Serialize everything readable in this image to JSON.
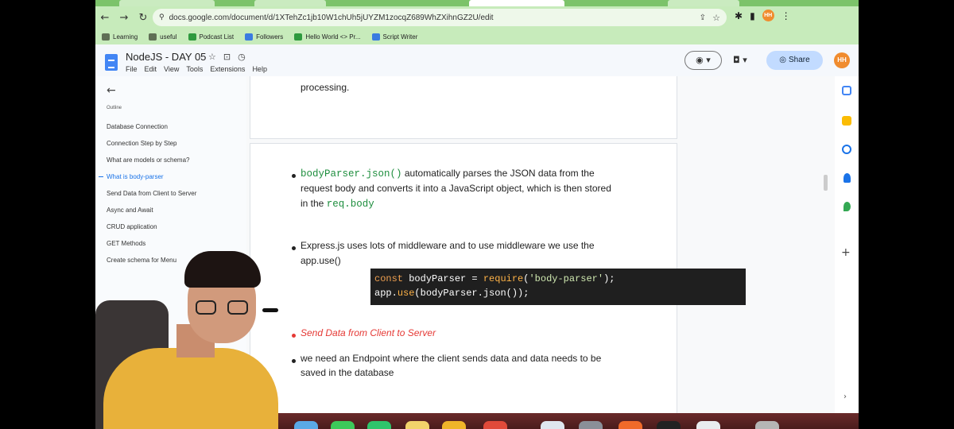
{
  "browser": {
    "url": "docs.google.com/document/d/1XTehZc1jb10W1chUh5jUYZM1zocqZ689WhZXihnGZ2U/edit",
    "profile_initials": "HH",
    "bookmarks": [
      {
        "label": "Learning",
        "icon": "folder-icon"
      },
      {
        "label": "useful",
        "icon": "folder-icon"
      },
      {
        "label": "Podcast List",
        "icon": "sheets-icon"
      },
      {
        "label": "Followers",
        "icon": "docs-icon"
      },
      {
        "label": "Hello World <> Pr...",
        "icon": "sheets-icon"
      },
      {
        "label": "Script Writer",
        "icon": "docs-icon"
      }
    ]
  },
  "doc": {
    "title": "NodeJS - DAY 05",
    "menu": [
      "File",
      "Edit",
      "View",
      "Tools",
      "Extensions",
      "Help"
    ],
    "share_label": "Share",
    "avatar_initials": "HH"
  },
  "outline": {
    "label": "Outline",
    "items": [
      "Database Connection",
      "Connection Step by Step",
      "What are models or schema?",
      "What is body-parser",
      "Send Data from Client to Server",
      "Async and Await",
      "CRUD application",
      "GET Methods",
      "Create schema for Menu"
    ],
    "active_index": 3
  },
  "content": {
    "page1_tail": "processing.",
    "bullet1": {
      "code": "bodyParser.json()",
      "line1": " automatically parses the JSON data from the",
      "line2": "request body and converts it into a JavaScript object, which is then stored",
      "line3_prefix": "in the ",
      "line3_code": "req.body"
    },
    "bullet2": {
      "line1": "Express.js uses lots of middleware and to use middleware we use the",
      "line2": "app.use()"
    },
    "code": {
      "l1_kw": "const",
      "l1_var": " bodyParser = ",
      "l1_fn": "require",
      "l1_open": "(",
      "l1_str": "'body-parser'",
      "l1_close": ");",
      "l2_obj": "app.",
      "l2_fn": "use",
      "l2_rest": "(bodyParser.json());"
    },
    "bullet3": "Send Data from Client to Server",
    "bullet4": {
      "line1": "we need an Endpoint where the client sends data and data needs to be",
      "line2": "saved in the database"
    }
  },
  "colors": {
    "chrome_green": "#c7ebbb",
    "share_blue": "#c2dbff",
    "link_blue": "#1a73e8",
    "code_green": "#1e8e3e",
    "heading_red": "#e53935"
  }
}
